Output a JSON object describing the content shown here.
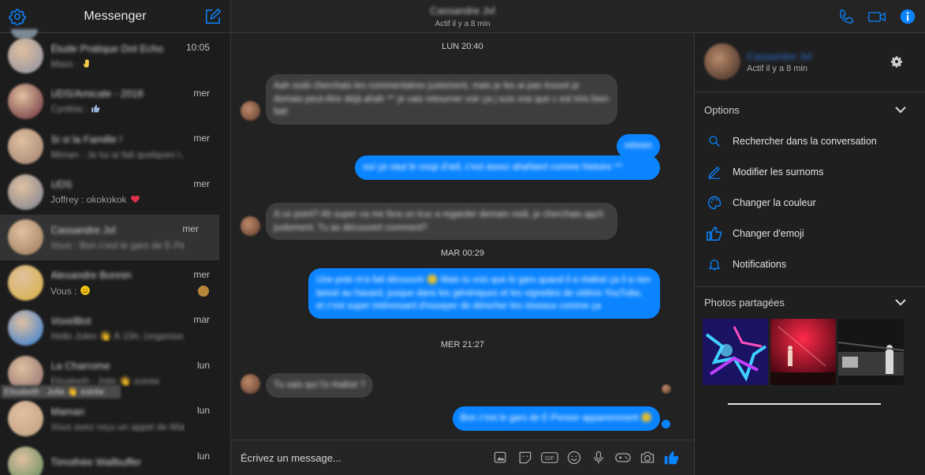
{
  "app": {
    "title": "Messenger",
    "accent": "#0a84ff"
  },
  "sidebar": {
    "conversations": [
      {
        "name": "Étude Pratique Dot Echo",
        "snippet_blur": "Maxs :",
        "snippet_clear": "",
        "time": "10:05",
        "emoji": "hand",
        "avatar": "#8a8fa0"
      },
      {
        "name": "UDS/Amicale - 2018",
        "snippet_blur": "Cynthia :",
        "snippet_clear": "",
        "time": "mer",
        "emoji": "like",
        "avatar": "#6a2a3a"
      },
      {
        "name": "Si si la Famille !",
        "snippet_blur": "Miman : Je lui ai fait quelques l...",
        "snippet_clear": "",
        "time": "mer",
        "emoji": "",
        "avatar": "#a08070"
      },
      {
        "name": "UDS",
        "snippet_blur": "",
        "snippet_clear": "Joffrey : okokokok",
        "time": "mer",
        "emoji": "heart",
        "avatar": "#7a8090"
      },
      {
        "name": "Cassandre Jvl",
        "snippet_blur": "Vous : Bon c'est le gars de E-Pe...",
        "snippet_clear": "",
        "time": "mer",
        "emoji": "",
        "avatar": "#9a7a5a"
      },
      {
        "name": "Alexandre Bonnin",
        "snippet_blur": "",
        "snippet_clear": "Vous :",
        "time": "mer",
        "emoji": "smile",
        "avatar": "#d8b040"
      },
      {
        "name": "VoxelBot",
        "snippet_blur": "Hello Jules 👋 À 15h, (organise...",
        "snippet_clear": "",
        "time": "mar",
        "emoji": "",
        "avatar": "#2a7ad8"
      },
      {
        "name": "La Charrome",
        "snippet_blur": "Elisabeth : Jolie 👋 soirée",
        "snippet_clear": "",
        "time": "lun",
        "emoji": "",
        "avatar": "#8a6a6a"
      },
      {
        "name": "Maman",
        "snippet_blur": "Vous avez reçu un appel de Mam...",
        "snippet_clear": "",
        "time": "lun",
        "emoji": "",
        "avatar": "#c0a080"
      },
      {
        "name": "Timothée Wallbuffer",
        "snippet_blur": "",
        "snippet_clear": "",
        "time": "lun",
        "emoji": "",
        "avatar": "#5a8a5a"
      }
    ],
    "tooltip": "Elisabeth : Jolie 👋 soirée"
  },
  "header": {
    "contact_name": "Cassandre Jvl",
    "status": "Actif il y a 8 min"
  },
  "messages": {
    "timestamps": [
      "LUN 20:40",
      "MAR 00:29",
      "MER 21:27"
    ],
    "bubbles": [
      {
        "dir": "in",
        "text": "Aah ouiiii cherchais les commentaires justement, mais je les ai pas trouvé je domais peut-être déjà ahah ^^ je vais retourner voir ça j suis vrai que c est très bien fait!"
      },
      {
        "dir": "out",
        "text": "mhmm"
      },
      {
        "dir": "out",
        "text": "oui ça vaut le coup d'œil, c'est assez ahahtant comme histoire ^^"
      },
      {
        "dir": "in",
        "text": "A ce point? Ah super ca me fera un truc a regarder demain midi, je cherchais qqch justement. Tu as découvert comment?"
      },
      {
        "dir": "out",
        "text": "Une pote m'a fait découvrir 🙂 Mais tu vois que le gars quand il a réalisé ça il a rien laissé au hasard, jusque dans les génériques et les vignettes de vidéos YouTube, et c'est super intéressant d'essayer de dénicher les réseaux comme ça"
      },
      {
        "dir": "in",
        "text": "Tu sais qui l'a réalisé ?"
      },
      {
        "dir": "out",
        "text": "Bon c'est le gars de E-Penser apparemment 🙂"
      }
    ]
  },
  "composer": {
    "placeholder": "Écrivez un message..."
  },
  "right_panel": {
    "name": "Cassandre Jvl",
    "status": "Actif il y a 8 min",
    "options_title": "Options",
    "options": [
      {
        "label": "Rechercher dans la conversation",
        "icon": "search-icon"
      },
      {
        "label": "Modifier les surnoms",
        "icon": "pencil-icon"
      },
      {
        "label": "Changer la couleur",
        "icon": "palette-icon"
      },
      {
        "label": "Changer d'emoji",
        "icon": "thumbs-up-icon"
      },
      {
        "label": "Notifications",
        "icon": "bell-icon"
      }
    ],
    "photos_title": "Photos partagées"
  }
}
